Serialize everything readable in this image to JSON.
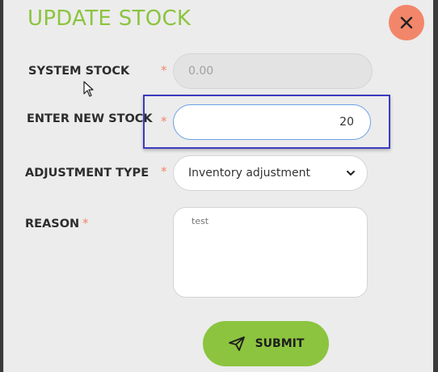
{
  "dialog": {
    "title": "UPDATE STOCK",
    "close_icon": "close-icon"
  },
  "form": {
    "system_stock": {
      "label": "SYSTEM STOCK",
      "required_mark": "*",
      "value": "0.00"
    },
    "new_stock": {
      "label": "ENTER NEW STOCK",
      "required_mark": "*",
      "value": "20"
    },
    "adjustment_type": {
      "label": "ADJUSTMENT TYPE",
      "required_mark": "*",
      "selected": "Inventory adjustment",
      "icon": "chevron-down-icon"
    },
    "reason": {
      "label": "REASON",
      "required_mark": "*",
      "value": "test"
    }
  },
  "submit": {
    "label": "SUBMIT",
    "icon": "paper-plane-icon"
  },
  "colors": {
    "accent_green": "#8cc43f",
    "close_bg": "#f2866a",
    "required": "#f2866a",
    "focus_border": "#3b3bbf"
  }
}
